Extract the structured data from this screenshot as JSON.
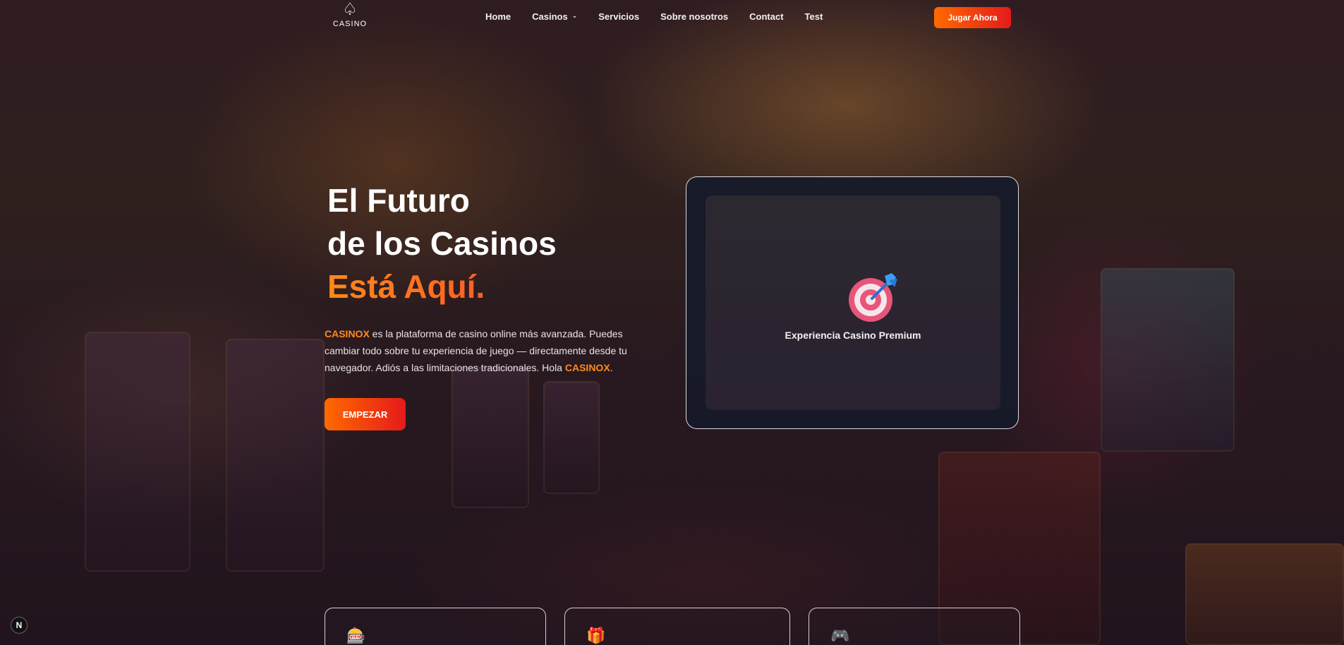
{
  "brand": {
    "logo_text": "CASINO",
    "logo_icon": "spade-icon"
  },
  "nav": {
    "items": [
      {
        "label": "Home"
      },
      {
        "label": "Casinos",
        "has_dropdown": true
      },
      {
        "label": "Servicios"
      },
      {
        "label": "Sobre nosotros"
      },
      {
        "label": "Contact"
      },
      {
        "label": "Test"
      }
    ],
    "cta_label": "Jugar Ahora"
  },
  "hero": {
    "title_line1": "El Futuro",
    "title_line2": "de los Casinos",
    "title_line3": "Está Aquí.",
    "desc_brand_1": "CASINOX",
    "desc_text": " es la plataforma de casino online más avanzada. Puedes cambiar todo sobre tu experiencia de juego — directamente desde tu navegador. Adiós a las limitaciones tradicionales. Hola ",
    "desc_brand_2": "CASINOX",
    "desc_end": ".",
    "button_label": "EMPEZAR"
  },
  "feature_card": {
    "icon": "target-icon",
    "label": "Experiencia Casino Premium"
  },
  "bottom_cards": [
    {
      "icon": "slot-machine-icon",
      "glyph": "🎰"
    },
    {
      "icon": "gift-icon",
      "glyph": "🎁"
    },
    {
      "icon": "gamepad-icon",
      "glyph": "🎮"
    }
  ],
  "corner_badge": {
    "text": "N"
  },
  "colors": {
    "accent_start": "#ff6a00",
    "accent_end": "#e51a1a",
    "brand_text": "#ff8a1a"
  }
}
